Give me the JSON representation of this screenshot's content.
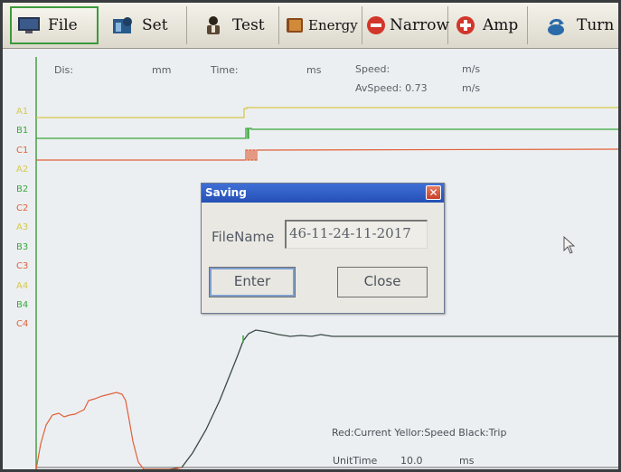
{
  "toolbar": {
    "items": [
      {
        "label": "File",
        "icon": "monitor-icon",
        "active": true
      },
      {
        "label": "Set",
        "icon": "settings-icon"
      },
      {
        "label": "Test",
        "icon": "person-icon"
      },
      {
        "label": "Energy",
        "icon": "book-icon"
      },
      {
        "label": "Narrow",
        "icon": "minus-circle-icon"
      },
      {
        "label": "Amp",
        "icon": "plus-circle-icon"
      },
      {
        "label": "Turn",
        "icon": "rotate-icon"
      }
    ]
  },
  "header": {
    "dis_label": "Dis:",
    "dis_unit": "mm",
    "time_label": "Time:",
    "time_unit": "ms",
    "speed_label": "Speed:",
    "speed_unit": "m/s",
    "avspeed_label": "AvSpeed: 0.73",
    "avspeed_unit": "m/s"
  },
  "channels": [
    "A1",
    "B1",
    "C1",
    "A2",
    "B2",
    "C2",
    "A3",
    "B3",
    "C3",
    "A4",
    "B4",
    "C4"
  ],
  "colors": {
    "A": "#d6c84a",
    "B": "#3aa63a",
    "C": "#e0603a",
    "trip": "#3a4a44"
  },
  "legend": "Red:Current  Yellor:Speed  Black:Trip",
  "unit_time": {
    "label": "UnitTime",
    "value": "10.0",
    "unit": "ms"
  },
  "dialog": {
    "title": "Saving",
    "close_glyph": "✕",
    "filename_label": "FileName",
    "filename_value": "46-11-24-11-2017",
    "enter_label": "Enter",
    "close_label": "Close"
  }
}
